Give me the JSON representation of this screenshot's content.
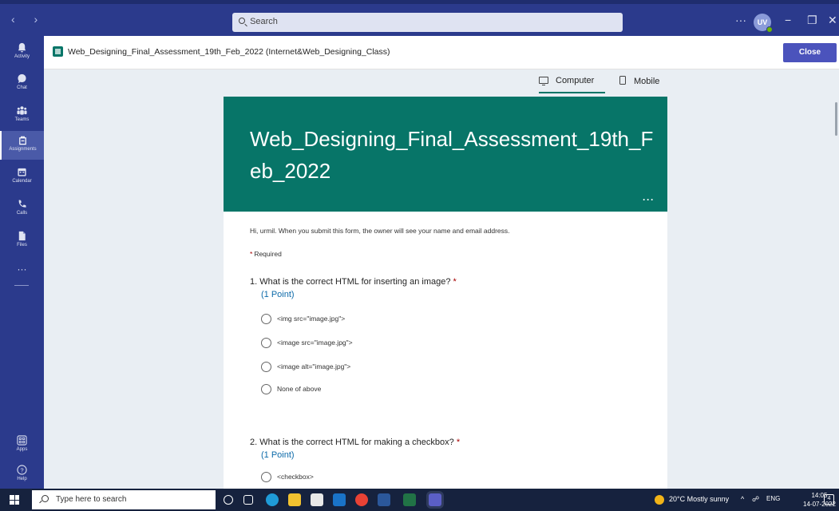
{
  "titlebar": {
    "search_placeholder": "Search",
    "more": "···",
    "avatar_initials": "UV",
    "minimize": "−",
    "maximize": "❐",
    "close": "✕"
  },
  "rail": {
    "items": [
      {
        "label": "Activity",
        "icon": "bell-icon"
      },
      {
        "label": "Chat",
        "icon": "chat-icon"
      },
      {
        "label": "Teams",
        "icon": "teams-icon"
      },
      {
        "label": "Assignments",
        "icon": "assignments-icon"
      },
      {
        "label": "Calendar",
        "icon": "calendar-icon"
      },
      {
        "label": "Calls",
        "icon": "phone-icon"
      },
      {
        "label": "Files",
        "icon": "file-icon"
      }
    ],
    "more": "···",
    "bottom": [
      {
        "label": "Apps",
        "icon": "apps-icon"
      },
      {
        "label": "Help",
        "icon": "help-icon"
      }
    ]
  },
  "app": {
    "title": "Web_Designing_Final_Assessment_19th_Feb_2022 (Internet&Web_Designing_Class)",
    "close_label": "Close"
  },
  "view_tabs": {
    "computer": "Computer",
    "mobile": "Mobile"
  },
  "form": {
    "title": "Web_Designing_Final_Assessment_19th_Feb_2022",
    "banner_more": "···",
    "notice": "Hi, urmil. When you submit this form, the owner will see your name and email address.",
    "required_label": "Required",
    "questions": [
      {
        "text": "1. What is the correct HTML for inserting an image?",
        "points": "(1 Point)",
        "options": [
          "<img src=\"image.jpg\">",
          "<image src=\"image.jpg\">",
          "<image alt=\"image.jpg\">",
          "None of above"
        ]
      },
      {
        "text": "2. What is the correct HTML for making a checkbox?",
        "points": "(1 Point)",
        "options": [
          "<checkbox>"
        ]
      }
    ]
  },
  "taskbar": {
    "search_placeholder": "Type here to search",
    "weather": "20°C  Mostly sunny",
    "lang": "ENG",
    "time": "14:05",
    "date": "14-07-2022",
    "notification_count": "4"
  },
  "colors": {
    "teams_purple": "#2b3a8c",
    "forms_teal": "#077568",
    "close_button": "#4b53bc",
    "points_blue": "#0c6aa9",
    "required_red": "#a80000"
  }
}
